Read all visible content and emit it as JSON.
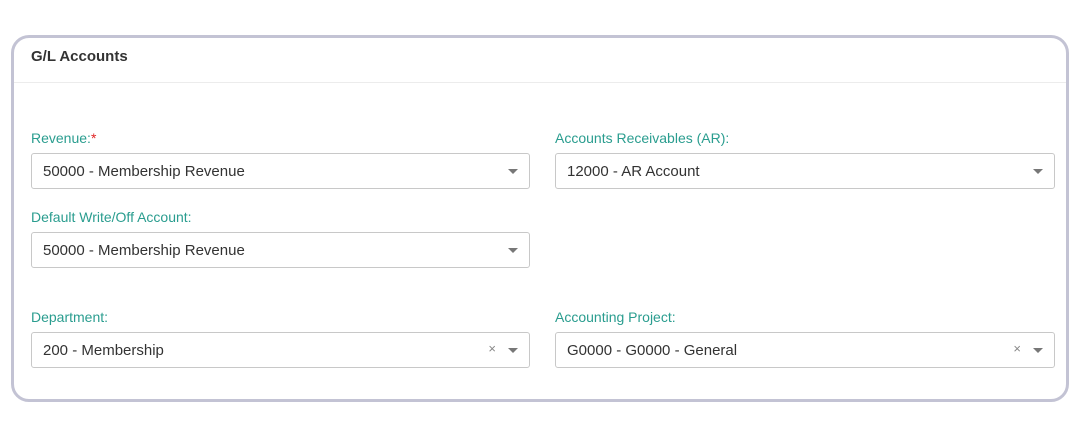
{
  "card": {
    "title": "G/L Accounts"
  },
  "fields": {
    "revenue": {
      "label": "Revenue:",
      "required_mark": "*",
      "value": "50000 - Membership Revenue"
    },
    "ar": {
      "label": "Accounts Receivables (AR):",
      "value": "12000 - AR Account"
    },
    "writeoff": {
      "label": "Default Write/Off Account:",
      "value": "50000 - Membership Revenue"
    },
    "department": {
      "label": "Department:",
      "value": "200 - Membership",
      "clear": "×"
    },
    "project": {
      "label": "Accounting Project:",
      "value": "G0000 - G0000 - General",
      "clear": "×"
    }
  },
  "icons": {
    "dropdown": "chevron-down-icon",
    "clear": "close-icon"
  },
  "colors": {
    "label": "#2a9d8f",
    "required": "#e02424",
    "card_border": "#c3c3d4"
  }
}
